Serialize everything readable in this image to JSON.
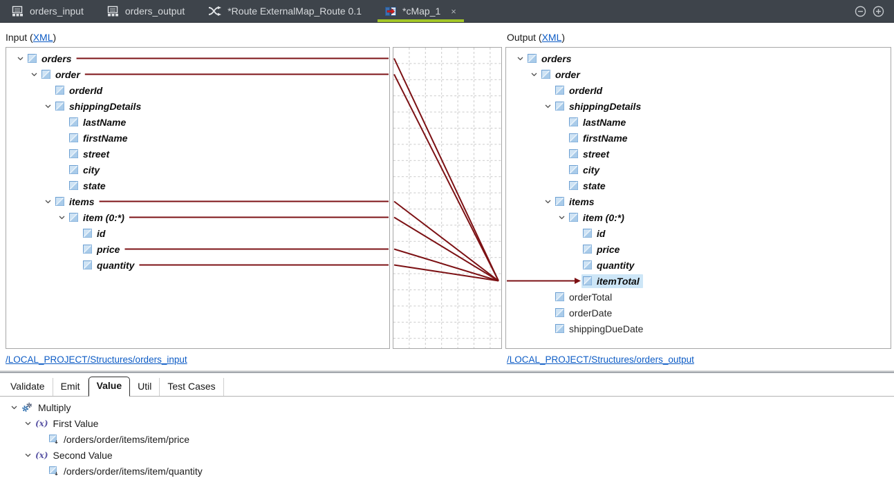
{
  "titlebar": {
    "tabs": [
      {
        "id": "orders-input",
        "label": "orders_input",
        "icon": "structure-icon",
        "active": false,
        "closable": false
      },
      {
        "id": "orders-output",
        "label": "orders_output",
        "icon": "structure-icon",
        "active": false,
        "closable": false
      },
      {
        "id": "route-externalmap",
        "label": "*Route ExternalMap_Route 0.1",
        "icon": "route-icon",
        "active": false,
        "closable": false
      },
      {
        "id": "cmap-1",
        "label": "*cMap_1",
        "icon": "map-icon",
        "active": true,
        "closable": true,
        "close_glyph": "×"
      }
    ],
    "window_controls": [
      {
        "id": "collapse",
        "icon": "collapse-icon"
      },
      {
        "id": "expand",
        "icon": "expand-icon"
      }
    ]
  },
  "input_panel": {
    "header": {
      "text": "Input (",
      "link": "XML",
      "suffix": ")"
    },
    "structure_link": "/LOCAL_PROJECT/Structures/orders_input",
    "tree": [
      {
        "label": "orders",
        "level": 0,
        "expandable": true
      },
      {
        "label": "order",
        "level": 1,
        "expandable": true
      },
      {
        "label": "orderId",
        "level": 2
      },
      {
        "label": "shippingDetails",
        "level": 2,
        "expandable": true
      },
      {
        "label": "lastName",
        "level": 3
      },
      {
        "label": "firstName",
        "level": 3
      },
      {
        "label": "street",
        "level": 3
      },
      {
        "label": "city",
        "level": 3
      },
      {
        "label": "state",
        "level": 3
      },
      {
        "label": "items",
        "level": 2,
        "expandable": true
      },
      {
        "label": "item (0:*)",
        "level": 3,
        "expandable": true
      },
      {
        "label": "id",
        "level": 4
      },
      {
        "label": "price",
        "level": 4
      },
      {
        "label": "quantity",
        "level": 4
      }
    ]
  },
  "output_panel": {
    "header": {
      "text": "Output (",
      "link": "XML",
      "suffix": ")"
    },
    "structure_link": "/LOCAL_PROJECT/Structures/orders_output",
    "tree": [
      {
        "label": "orders",
        "level": 0,
        "expandable": true
      },
      {
        "label": "order",
        "level": 1,
        "expandable": true
      },
      {
        "label": "orderId",
        "level": 2
      },
      {
        "label": "shippingDetails",
        "level": 2,
        "expandable": true
      },
      {
        "label": "lastName",
        "level": 3
      },
      {
        "label": "firstName",
        "level": 3
      },
      {
        "label": "street",
        "level": 3
      },
      {
        "label": "city",
        "level": 3
      },
      {
        "label": "state",
        "level": 3
      },
      {
        "label": "items",
        "level": 2,
        "expandable": true
      },
      {
        "label": "item (0:*)",
        "level": 3,
        "expandable": true
      },
      {
        "label": "id",
        "level": 4
      },
      {
        "label": "price",
        "level": 4
      },
      {
        "label": "quantity",
        "level": 4
      },
      {
        "label": "itemTotal",
        "level": 4,
        "selected": true
      },
      {
        "label": "orderTotal",
        "level": 2,
        "plain": true
      },
      {
        "label": "orderDate",
        "level": 2,
        "plain": true
      },
      {
        "label": "shippingDueDate",
        "level": 2,
        "plain": true
      }
    ]
  },
  "mappings": {
    "sources": [
      "orders",
      "order",
      "items",
      "item (0:*)",
      "price",
      "quantity"
    ],
    "target": "itemTotal",
    "line_color": "#7c1114"
  },
  "bottom_panel": {
    "tabs": [
      {
        "label": "Validate",
        "active": false
      },
      {
        "label": "Emit",
        "active": false
      },
      {
        "label": "Value",
        "active": true
      },
      {
        "label": "Util",
        "active": false
      },
      {
        "label": "Test Cases",
        "active": false
      }
    ],
    "tree": [
      {
        "label": "Multiply",
        "level": 0,
        "expandable": true,
        "icon": "gears-icon"
      },
      {
        "label": "First Value",
        "level": 1,
        "expandable": true,
        "icon": "function-icon"
      },
      {
        "label": "/orders/order/items/item/price",
        "level": 2,
        "icon": "xpath-icon"
      },
      {
        "label": "Second Value",
        "level": 1,
        "expandable": true,
        "icon": "function-icon"
      },
      {
        "label": "/orders/order/items/item/quantity",
        "level": 2,
        "icon": "xpath-icon"
      }
    ]
  }
}
